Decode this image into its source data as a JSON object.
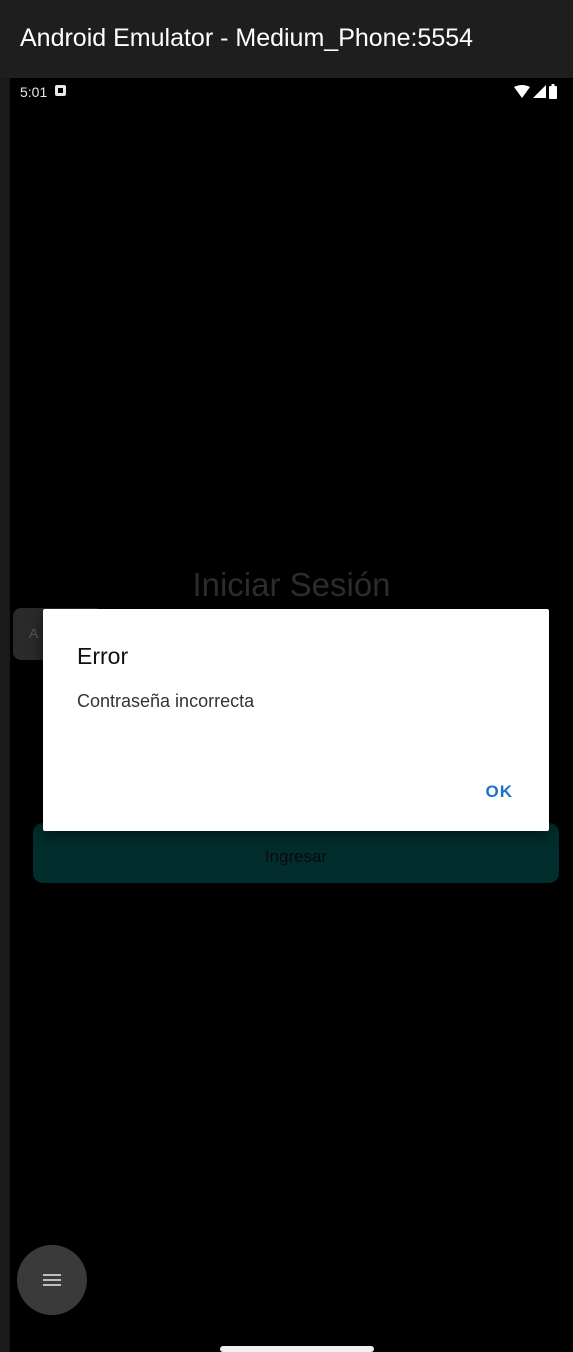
{
  "window": {
    "title": "Android Emulator - Medium_Phone:5554"
  },
  "status_bar": {
    "time": "5:01",
    "notification_icon": "a-icon",
    "wifi_icon": "wifi-icon",
    "signal_icon": "signal-icon",
    "battery_icon": "battery-icon"
  },
  "login": {
    "title": "Iniciar Sesión",
    "field_partial_text": "A",
    "submit_label": "Ingresar"
  },
  "dialog": {
    "title": "Error",
    "message": "Contraseña incorrecta",
    "ok_label": "OK"
  },
  "fab": {
    "icon": "menu-icon"
  },
  "colors": {
    "titlebar_bg": "#1e1e1e",
    "screen_bg": "#000000",
    "dialog_bg": "#ffffff",
    "ok_accent": "#1a73c8",
    "button_bg": "#012d2d",
    "fab_bg": "#3a3a3a"
  }
}
